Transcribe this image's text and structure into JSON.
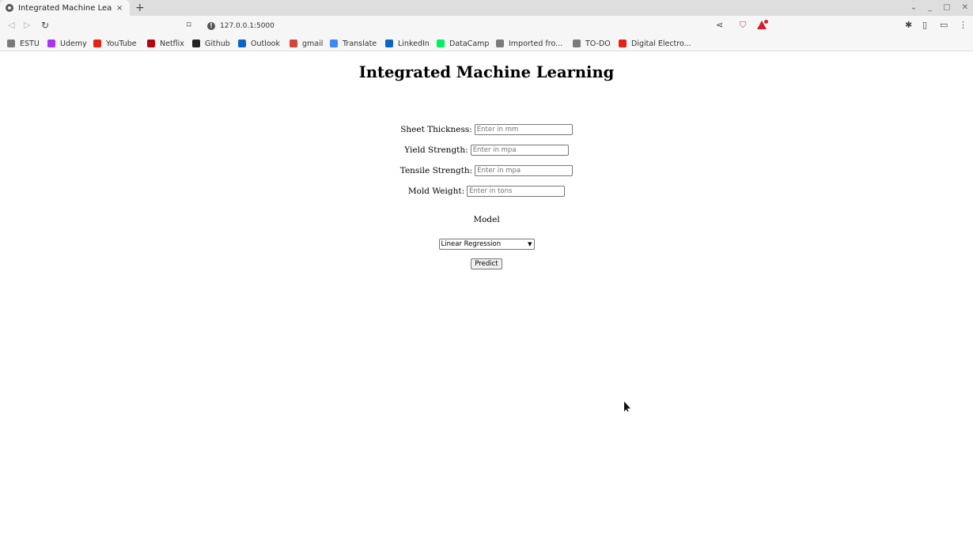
{
  "browser": {
    "tab": {
      "title": "Integrated Machine Learning",
      "close_glyph": "×"
    },
    "new_tab_glyph": "+",
    "window_controls": {
      "minimize": "_",
      "maximize": "▢",
      "close": "✕"
    },
    "url": "127.0.0.1:5000",
    "bookmarks": [
      {
        "label": "ESTU",
        "icon": "folder-icon",
        "color": "#7a7a7a"
      },
      {
        "label": "Udemy",
        "icon": "udemy-icon",
        "color": "#a435f0"
      },
      {
        "label": "YouTube",
        "icon": "youtube-icon",
        "color": "#e62117"
      },
      {
        "label": "Netflix",
        "icon": "netflix-icon",
        "color": "#b1060f"
      },
      {
        "label": "Github",
        "icon": "github-icon",
        "color": "#222222"
      },
      {
        "label": "Outlook",
        "icon": "outlook-icon",
        "color": "#0a64c8"
      },
      {
        "label": "gmail",
        "icon": "gmail-icon",
        "color": "#d44638"
      },
      {
        "label": "Translate",
        "icon": "translate-icon",
        "color": "#4285f4"
      },
      {
        "label": "LinkedIn",
        "icon": "linkedin-icon",
        "color": "#0a66c2"
      },
      {
        "label": "DataCamp",
        "icon": "datacamp-icon",
        "color": "#03ef62"
      },
      {
        "label": "Imported fro...",
        "icon": "folder-icon",
        "color": "#7a7a7a"
      },
      {
        "label": "TO-DO",
        "icon": "folder-icon",
        "color": "#7a7a7a"
      },
      {
        "label": "Digital Electro...",
        "icon": "youtube-icon",
        "color": "#e62117"
      }
    ]
  },
  "page": {
    "title": "Integrated Machine Learning",
    "fields": [
      {
        "label": "Sheet Thickness:",
        "placeholder": "Enter in mm",
        "value": ""
      },
      {
        "label": "Yield Strength:",
        "placeholder": "Enter in mpa",
        "value": ""
      },
      {
        "label": "Tensile Strength:",
        "placeholder": "Enter in mpa",
        "value": ""
      },
      {
        "label": "Mold Weight:",
        "placeholder": "Enter in tons",
        "value": ""
      }
    ],
    "model_label": "Model",
    "model_selected": "Linear Regression",
    "predict_label": "Predict"
  }
}
